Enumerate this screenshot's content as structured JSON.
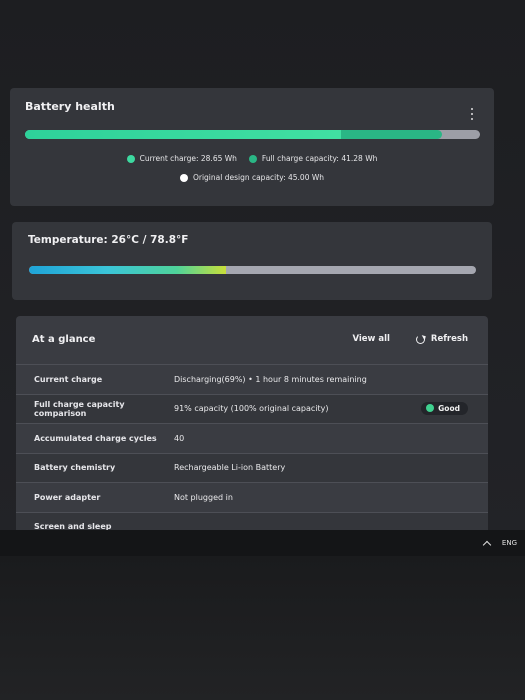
{
  "battery_health": {
    "title": "Battery health",
    "current_charge_fraction": 0.694,
    "full_capacity_fraction": 0.917,
    "legend": {
      "current": "Current charge: 28.65 Wh",
      "full": "Full charge capacity: 41.28 Wh",
      "design": "Original design capacity: 45.00 Wh"
    },
    "colors": {
      "current": "#3dd9a0",
      "full": "#2ab685",
      "design": "#ffffff"
    }
  },
  "temperature": {
    "title": "Temperature:  26°C / 78.8°F",
    "level_fraction": 0.44
  },
  "at_a_glance": {
    "title": "At a glance",
    "view_all": "View all",
    "refresh": "Refresh",
    "rows": [
      {
        "label": "Current charge",
        "value": "Discharging(69%)  •  1 hour 8 minutes remaining"
      },
      {
        "label": "Full charge capacity comparison",
        "value": "91% capacity (100% original capacity)",
        "badge": "Good"
      },
      {
        "label": "Accumulated charge cycles",
        "value": "40"
      },
      {
        "label": "Battery chemistry",
        "value": "Rechargeable Li-ion Battery"
      },
      {
        "label": "Power adapter",
        "value": "Not plugged in"
      },
      {
        "label": "Screen and sleep",
        "value": ""
      }
    ]
  },
  "taskbar": {
    "language": "ENG"
  }
}
